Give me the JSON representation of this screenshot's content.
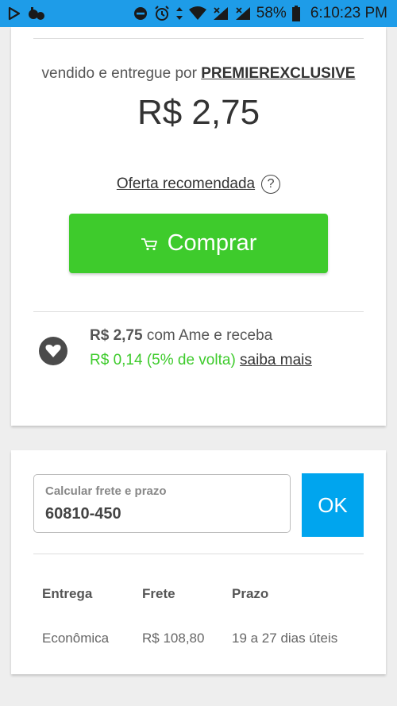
{
  "status_bar": {
    "battery": "58%",
    "time": "6:10:23 PM"
  },
  "product": {
    "seller_prefix": "vendido e entregue por",
    "seller_name": "PREMIEREXCLUSIVE",
    "price": "R$ 2,75",
    "offer_label": "Oferta recomendada",
    "help_icon": "?",
    "buy_label": "Comprar"
  },
  "cashback": {
    "price": "R$ 2,75",
    "text": "com Ame e receba",
    "cashback_value": "R$ 0,14 (5% de volta)",
    "link": "saiba mais"
  },
  "shipping": {
    "placeholder": "Calcular frete e prazo",
    "cep": "60810-450",
    "ok_label": "OK",
    "headers": [
      "Entrega",
      "Frete",
      "Prazo"
    ],
    "rows": [
      [
        "Econômica",
        "R$ 108,80",
        "19 a 27 dias úteis"
      ]
    ]
  },
  "colors": {
    "status_bar": "#1e9ce8",
    "buy_button": "#3ecb2c",
    "cashback_green": "#3ecb2c",
    "ok_button": "#00a5ee"
  }
}
